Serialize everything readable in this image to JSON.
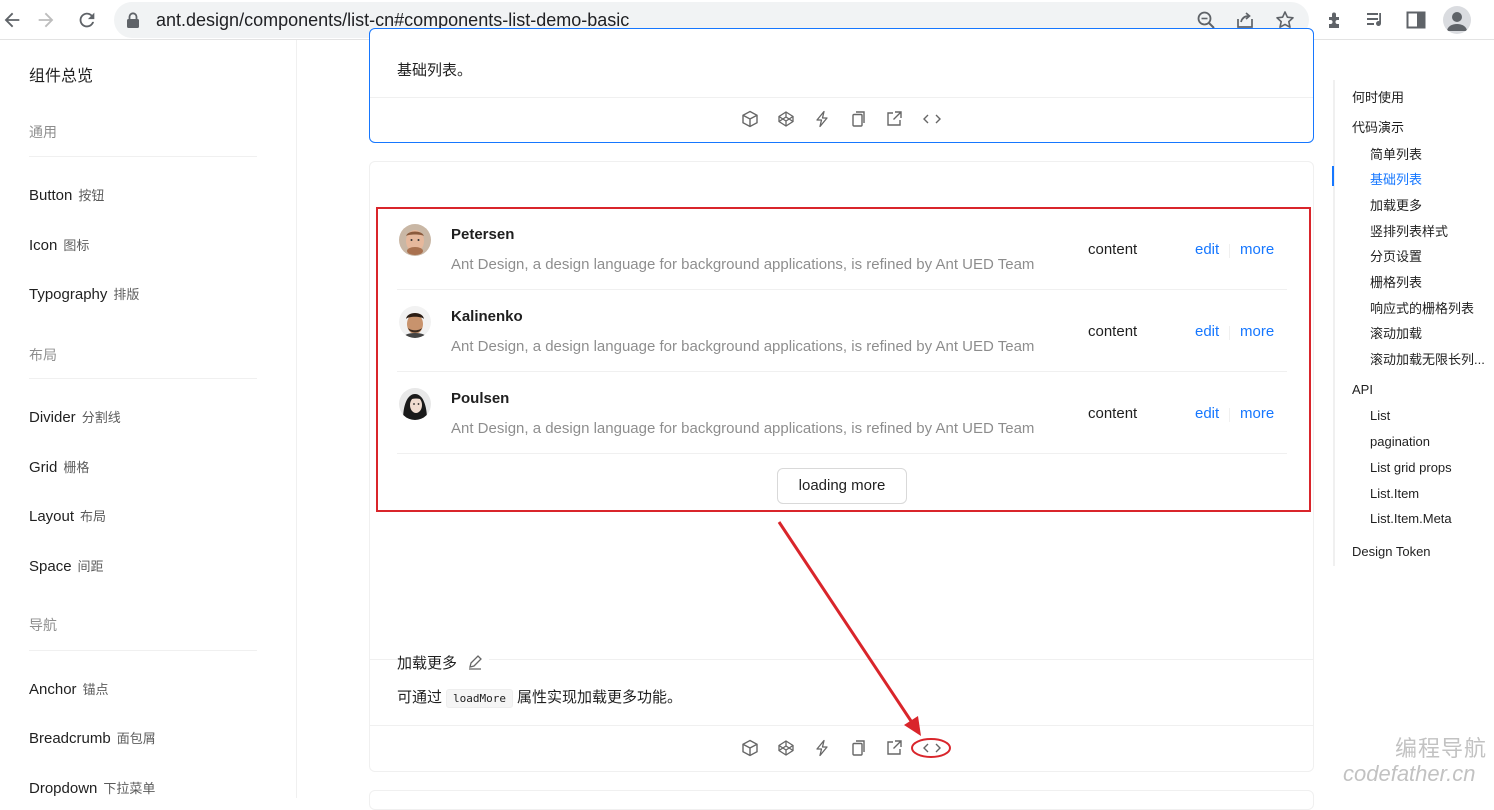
{
  "browser": {
    "url": "ant.design/components/list-cn#components-list-demo-basic"
  },
  "sidebar": {
    "overview": "组件总览",
    "groups": [
      {
        "label": "通用",
        "items": [
          {
            "label": "Button",
            "sub": "按钮"
          },
          {
            "label": "Icon",
            "sub": "图标"
          },
          {
            "label": "Typography",
            "sub": "排版"
          }
        ]
      },
      {
        "label": "布局",
        "items": [
          {
            "label": "Divider",
            "sub": "分割线"
          },
          {
            "label": "Grid",
            "sub": "栅格"
          },
          {
            "label": "Layout",
            "sub": "布局"
          },
          {
            "label": "Space",
            "sub": "间距"
          }
        ]
      },
      {
        "label": "导航",
        "items": [
          {
            "label": "Anchor",
            "sub": "锚点"
          },
          {
            "label": "Breadcrumb",
            "sub": "面包屑"
          },
          {
            "label": "Dropdown",
            "sub": "下拉菜单"
          }
        ]
      }
    ]
  },
  "demo_basic": {
    "description": "基础列表。"
  },
  "demo_loadmore": {
    "items": [
      {
        "title": "Petersen",
        "desc": "Ant Design, a design language for background applications, is refined by Ant UED Team",
        "content": "content",
        "edit": "edit",
        "more": "more"
      },
      {
        "title": "Kalinenko",
        "desc": "Ant Design, a design language for background applications, is refined by Ant UED Team",
        "content": "content",
        "edit": "edit",
        "more": "more"
      },
      {
        "title": "Poulsen",
        "desc": "Ant Design, a design language for background applications, is refined by Ant UED Team",
        "content": "content",
        "edit": "edit",
        "more": "more"
      }
    ],
    "load_more_label": "loading more",
    "meta_title": "加载更多",
    "desc_before": "可通过",
    "desc_code": "loadMore",
    "desc_after": "属性实现加载更多功能。"
  },
  "anchor": {
    "items": [
      {
        "label": "何时使用",
        "level": 1
      },
      {
        "label": "代码演示",
        "level": 1
      },
      {
        "label": "简单列表",
        "level": 2
      },
      {
        "label": "基础列表",
        "level": 2,
        "active": true
      },
      {
        "label": "加载更多",
        "level": 2
      },
      {
        "label": "竖排列表样式",
        "level": 2
      },
      {
        "label": "分页设置",
        "level": 2
      },
      {
        "label": "栅格列表",
        "level": 2
      },
      {
        "label": "响应式的栅格列表",
        "level": 2
      },
      {
        "label": "滚动加载",
        "level": 2
      },
      {
        "label": "滚动加载无限长列...",
        "level": 2
      },
      {
        "label": "API",
        "level": 1
      },
      {
        "label": "List",
        "level": 2
      },
      {
        "label": "pagination",
        "level": 2
      },
      {
        "label": "List grid props",
        "level": 2
      },
      {
        "label": "List.Item",
        "level": 2
      },
      {
        "label": "List.Item.Meta",
        "level": 2
      },
      {
        "label": "Design Token",
        "level": 1
      }
    ]
  },
  "watermark": {
    "line1": "编程导航",
    "line2": "codefather.cn"
  },
  "colors": {
    "primary": "#1677ff",
    "annotation_red": "#d9252b"
  }
}
